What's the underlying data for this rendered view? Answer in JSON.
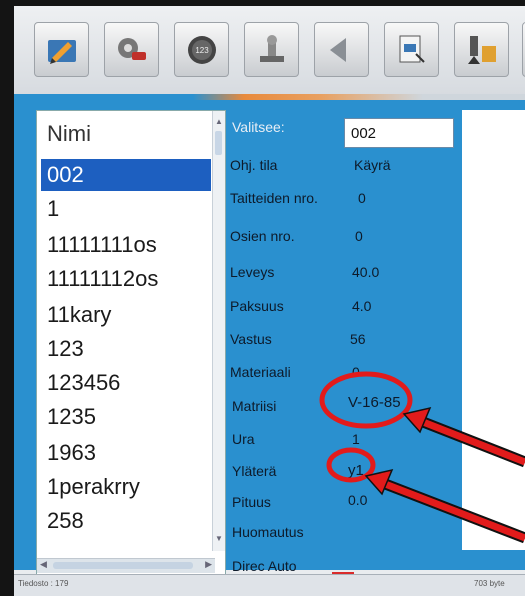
{
  "toolbar": {
    "buttons": [
      {
        "name": "pencil-edit-icon"
      },
      {
        "name": "tools-gear-icon"
      },
      {
        "name": "counter-dial-icon",
        "text": "123"
      },
      {
        "name": "stamp-icon"
      },
      {
        "name": "arrow-left-icon"
      },
      {
        "name": "document-pointer-icon"
      },
      {
        "name": "bend-tool-icon"
      },
      {
        "name": "wrench-settings-icon"
      },
      {
        "name": "extra-icon"
      }
    ]
  },
  "list": {
    "header": "Nimi",
    "items": [
      "002",
      "1",
      "11111111os",
      "11111112os",
      "11kary",
      "123",
      "123456",
      "1235",
      "1963",
      "1perakrry",
      "258"
    ],
    "selected_index": 0
  },
  "properties": {
    "valitsee_label": "Valitsee:",
    "valitsee_value": "002",
    "rows": [
      {
        "label": "Ohj. tila",
        "value": "Käyrä"
      },
      {
        "label": "Taitteiden nro.",
        "value": "0"
      },
      {
        "label": "Osien nro.",
        "value": "0"
      },
      {
        "label": "Leveys",
        "value": "40.0"
      },
      {
        "label": "Paksuus",
        "value": "4.0"
      },
      {
        "label": "Vastus",
        "value": "56"
      },
      {
        "label": "Materiaali",
        "value": "0"
      },
      {
        "label": "Matriisi",
        "value": "V-16-85"
      },
      {
        "label": "Ura",
        "value": "1"
      },
      {
        "label": "Yläterä",
        "value": "y1"
      },
      {
        "label": "Pituus",
        "value": "0.0"
      },
      {
        "label": "Huomautus",
        "value": ""
      },
      {
        "label": "Direc Auto",
        "value": ""
      }
    ]
  },
  "status": {
    "left": "Tiedosto : 179",
    "right": "703 byte"
  },
  "colors": {
    "panel_blue": "#2a90cf",
    "selection_blue": "#1d5fc0",
    "annotation_red": "#e21b1b",
    "accent_orange": "#e88a3c"
  }
}
